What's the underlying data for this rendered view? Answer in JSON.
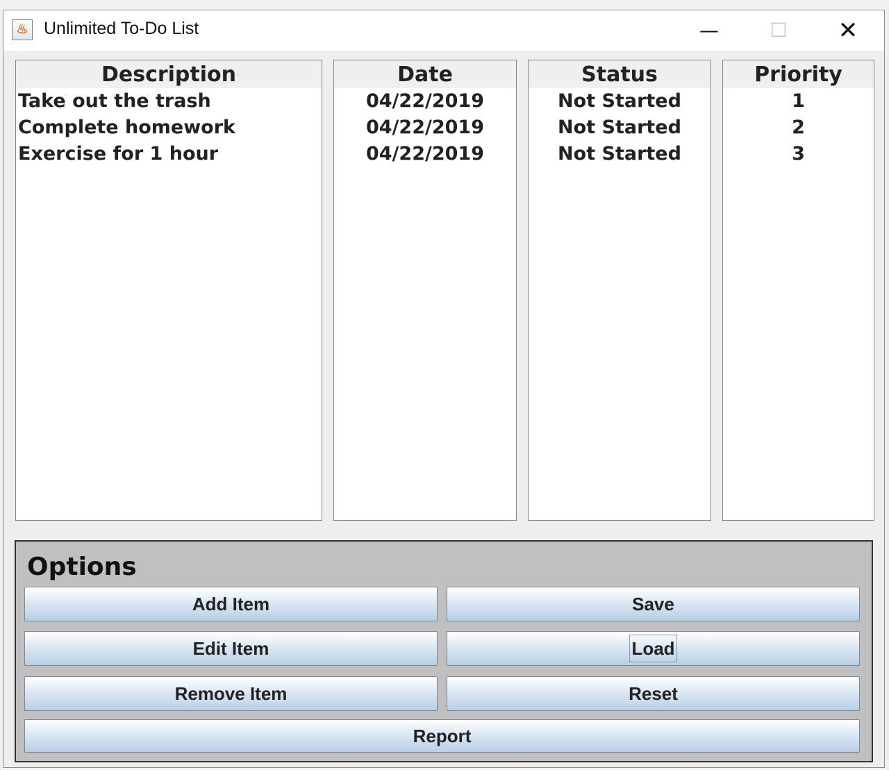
{
  "window": {
    "title": "Unlimited To-Do List",
    "icon": "java-icon",
    "controls": {
      "minimize": "—",
      "maximize": "☐",
      "close": "✕"
    }
  },
  "table": {
    "headers": {
      "description": "Description",
      "date": "Date",
      "status": "Status",
      "priority": "Priority"
    },
    "rows": [
      {
        "description": "Take out the trash",
        "date": "04/22/2019",
        "status": "Not Started",
        "priority": "1"
      },
      {
        "description": "Complete homework",
        "date": "04/22/2019",
        "status": "Not Started",
        "priority": "2"
      },
      {
        "description": "Exercise for 1 hour",
        "date": "04/22/2019",
        "status": "Not Started",
        "priority": "3"
      }
    ]
  },
  "options": {
    "title": "Options",
    "add_item": "Add Item",
    "edit_item": "Edit Item",
    "remove_item": "Remove Item",
    "save": "Save",
    "load": "Load",
    "reset": "Reset",
    "report": "Report"
  },
  "colors": {
    "panel_background": "#c0c0c0",
    "button_gradient_top": "#ffffff",
    "button_gradient_bottom": "#b8cfe5"
  }
}
